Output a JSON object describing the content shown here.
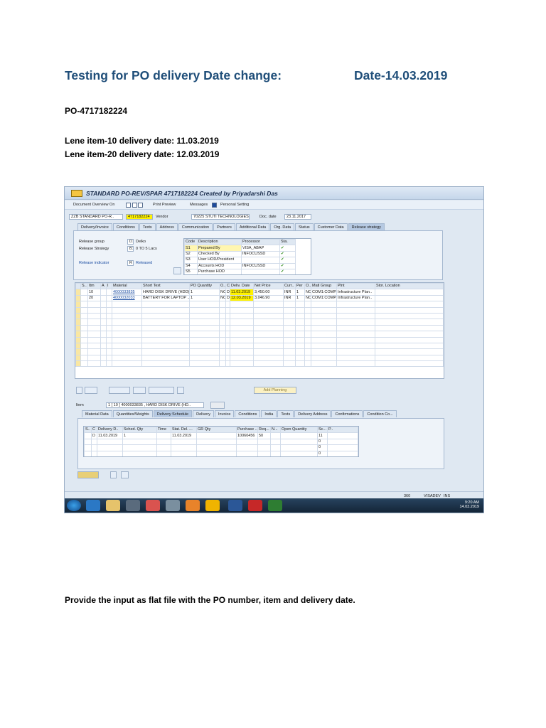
{
  "doc": {
    "title_left": "Testing for PO delivery Date change:",
    "title_right": "Date-14.03.2019",
    "po_line": "PO-4717182224",
    "item10_line": "Lene item-10 delivery date: 11.03.2019",
    "item20_line": "Lene item-20 delivery date: 12.03.2019",
    "footer_line": "Provide the input as flat file with the PO number, item and delivery date."
  },
  "sap": {
    "window_title": "STANDARD PO-REV/SPAR 4717182224 Created by Priyadarshi Das",
    "toolbar": {
      "doc_overview": "Document Overview On",
      "print_preview": "Print Preview",
      "messages": "Messages",
      "personal_setting": "Personal Setting"
    },
    "header": {
      "doc_type": "ZZB STANDARD PO-R..",
      "po_number": "4717182224",
      "vendor_label": "Vendor",
      "vendor_value": "70225 STUTI TECHNOLOGIES",
      "doc_date_label": "Doc. date",
      "doc_date_value": "23.11.2017"
    },
    "header_tabs": [
      "Delivery/Invoice",
      "Conditions",
      "Texts",
      "Address",
      "Communication",
      "Partners",
      "Additional Data",
      "Org. Data",
      "Status",
      "Customer Data",
      "Release strategy"
    ],
    "release": {
      "group_label": "Release group",
      "group_code": "D1",
      "group_text": "Delko",
      "strategy_label": "Release Strategy",
      "strategy_code": "B1",
      "strategy_text": "0 TO 5 Lacs",
      "indicator_label": "Release indicator",
      "indicator_code": "R",
      "indicator_text": "Released",
      "columns": [
        "Code",
        "Description",
        "Processor",
        "Sta."
      ],
      "rows": [
        [
          "S1",
          "Prepared By",
          "VISA_ABAP",
          "✔"
        ],
        [
          "S2",
          "Checked By",
          "INFOCUSSD",
          "✔"
        ],
        [
          "S3",
          "User HOD/President",
          "",
          "✔"
        ],
        [
          "S4",
          "Accounts HOD",
          "INFOCUSSD",
          "✔"
        ],
        [
          "S5",
          "Purchase HOD",
          "",
          "✔"
        ]
      ]
    },
    "items": {
      "columns": [
        "S..",
        "Itm",
        "A",
        "I",
        "Material",
        "Short Text",
        "PO Quantity",
        "O..",
        "C",
        "Deliv. Date",
        "Net Price",
        "Curr..",
        "Per",
        "O..",
        "Matl Group",
        "Plnt",
        "Stor. Location"
      ],
      "rows": [
        [
          "",
          "10",
          "",
          "",
          "4000033835",
          "HARD DISK DRIVE (HDD)..",
          "1",
          "NO",
          "D",
          "11.03.2019",
          "3,450.00",
          "INR",
          "1",
          "NO",
          "COM1:COMP..",
          "Infrastructure Plan..",
          ""
        ],
        [
          "",
          "20",
          "",
          "",
          "4000032033",
          "BATTERY FOR LAPTOP ..",
          "1",
          "NO",
          "D",
          "12.03.2019",
          "3,046.90",
          "INR",
          "1",
          "NO",
          "COM1:COMP..",
          "Infrastructure Plan..",
          ""
        ]
      ],
      "add_planning": "Add Planning"
    },
    "item_detail": {
      "item_label": "Item",
      "item_value": "1 [ 10 ] 4000033835 , HARD DISK DRIVE (HD..",
      "tabs": [
        "Material Data",
        "Quantities/Weights",
        "Delivery Schedule",
        "Delivery",
        "Invoice",
        "Conditions",
        "India",
        "Texts",
        "Delivery Address",
        "Confirmations",
        "Condition Co..."
      ],
      "columns": [
        "S..",
        "C",
        "Delivery D..",
        "Sched. Qty",
        "Time",
        "Stat. Del. ...",
        "GR Qty",
        "Purchase ...",
        "Req...",
        "N...",
        "Open Quantity",
        "Sc...",
        "P.."
      ],
      "rows": [
        [
          "",
          "D",
          "11.03.2019",
          "1",
          "",
          "11.03.2019",
          "",
          "10060456",
          "50",
          "",
          "",
          "11",
          ""
        ],
        [
          "",
          "",
          "",
          "",
          "",
          "",
          "",
          "",
          "",
          "",
          "",
          "0",
          ""
        ],
        [
          "",
          "",
          "",
          "",
          "",
          "",
          "",
          "",
          "",
          "",
          "",
          "0",
          ""
        ],
        [
          "",
          "",
          "",
          "",
          "",
          "",
          "",
          "",
          "",
          "",
          "",
          "0",
          ""
        ]
      ]
    },
    "statusbar": {
      "client": "360",
      "system": "VISADEV",
      "mode": "INS"
    },
    "clock": {
      "time": "9:20 AM",
      "date": "14.03.2019"
    }
  },
  "colors": {
    "title": "#1f4e79",
    "highlight": "#fff200",
    "sap_bg": "#dfe8f2"
  }
}
